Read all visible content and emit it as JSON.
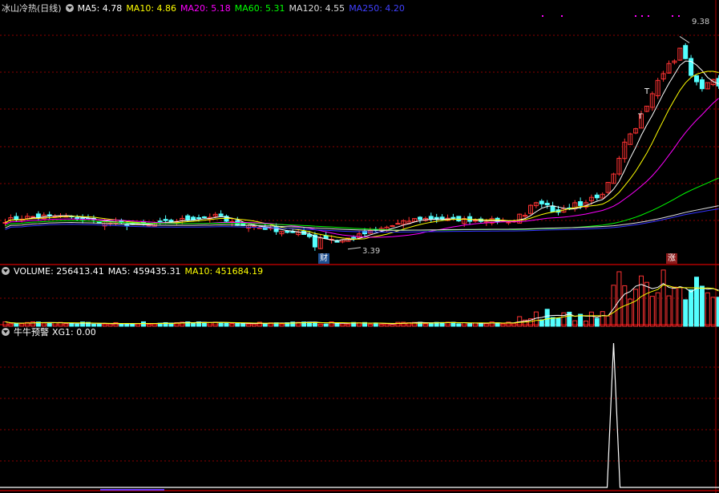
{
  "price_header": {
    "title": "冰山冷热(日线)",
    "ma5": "MA5: 4.78",
    "ma10": "MA10: 4.86",
    "ma20": "MA20: 5.18",
    "ma60": "MA60: 5.31",
    "ma120": "MA120: 4.55",
    "ma250": "MA250: 4.20"
  },
  "volume_header": {
    "volume": "VOLUME: 256413.41",
    "ma5": "MA5: 459435.31",
    "ma10": "MA10: 451684.19"
  },
  "indicator_header": {
    "title": "牛牛预警",
    "xg1": "XG1: 0.00"
  },
  "annotations": {
    "high_label": "9.38",
    "low_label": "3.39",
    "cai_tag": "财",
    "zhang_tag": "涨",
    "t_mark1": "T",
    "t_mark2": "T"
  },
  "colors": {
    "up": "#ff3333",
    "down": "#54ffff",
    "ma5": "#ffffff",
    "ma10": "#ffff00",
    "ma20": "#ff00ff",
    "ma60": "#00ff00",
    "ma120": "#dddddd",
    "ma250": "#3333ff",
    "grid": "#8b0000"
  },
  "chart_data": {
    "type": "candlestick",
    "n_bars": 130,
    "price_range": [
      3.0,
      10.0
    ],
    "anchors": {
      "high": 9.38,
      "low": 3.39
    },
    "late_closes": [
      {
        "bar": 93,
        "close": 4.35
      },
      {
        "bar": 96,
        "close": 4.6
      },
      {
        "bar": 99,
        "close": 4.5
      },
      {
        "bar": 102,
        "close": 4.65
      },
      {
        "bar": 105,
        "close": 4.7
      },
      {
        "bar": 108,
        "close": 5.0
      },
      {
        "bar": 110,
        "close": 5.6
      },
      {
        "bar": 112,
        "close": 6.3
      },
      {
        "bar": 114,
        "close": 6.9
      },
      {
        "bar": 116,
        "close": 7.3
      },
      {
        "bar": 118,
        "close": 8.2
      },
      {
        "bar": 120,
        "close": 8.6
      },
      {
        "bar": 122,
        "close": 9.0
      },
      {
        "bar": 124,
        "close": 8.4
      },
      {
        "bar": 126,
        "close": 8.0
      },
      {
        "bar": 129,
        "close": 8.1
      }
    ],
    "xg1_signal_bar": 110,
    "xg1_value": 0.0
  }
}
